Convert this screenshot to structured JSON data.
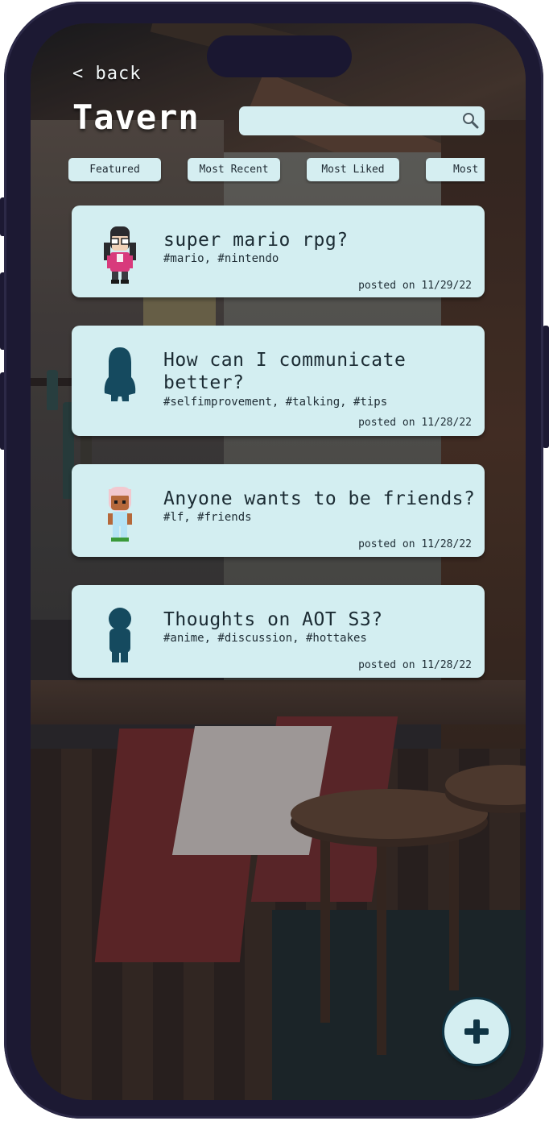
{
  "nav": {
    "back_label": "< back"
  },
  "page": {
    "title": "Tavern"
  },
  "search": {
    "value": "",
    "placeholder": ""
  },
  "tabs": [
    {
      "label": "Featured"
    },
    {
      "label": "Most Recent"
    },
    {
      "label": "Most Liked"
    },
    {
      "label": "Most C"
    }
  ],
  "posts": [
    {
      "title_lines": [
        "super mario rpg?"
      ],
      "tags": "#mario, #nintendo",
      "date": "posted on 11/29/22",
      "avatar": "girl-glasses-avatar"
    },
    {
      "title_lines": [
        "How can I communicate",
        "better?"
      ],
      "tags": "#selfimprovement, #talking, #tips",
      "date": "posted on 11/28/22",
      "avatar": "silhouette-avatar"
    },
    {
      "title_lines": [
        "Anyone wants to be friends?"
      ],
      "tags": "#lf, #friends",
      "date": "posted on 11/28/22",
      "avatar": "pink-hair-kid-avatar"
    },
    {
      "title_lines": [
        "Thoughts on AOT S3?"
      ],
      "tags": "#anime, #discussion, #hottakes",
      "date": "posted on 11/28/22",
      "avatar": "silhouette-avatar"
    }
  ],
  "fab": {
    "icon": "plus-icon"
  },
  "colors": {
    "card": "#d3eef1",
    "accent": "#0f3444",
    "frame": "#1c1933"
  }
}
